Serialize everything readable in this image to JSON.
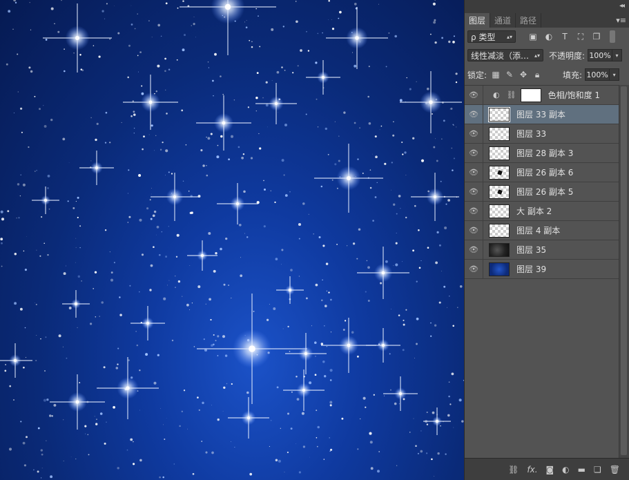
{
  "panel": {
    "collapse_glyph": "◂◂",
    "menu_glyph": "▾≡",
    "tabs": [
      {
        "label": "图层",
        "active": true
      },
      {
        "label": "通道",
        "active": false
      },
      {
        "label": "路径",
        "active": false
      }
    ],
    "filter": {
      "label": "ρ 类型",
      "icons": [
        "image-filter-icon",
        "adjustment-filter-icon",
        "text-filter-icon",
        "shape-filter-icon",
        "smart-object-filter-icon"
      ]
    },
    "blend_mode": "线性减淡（添…",
    "opacity_label": "不透明度:",
    "opacity_value": "100%",
    "lock_label": "锁定:",
    "fill_label": "填充:",
    "fill_value": "100%"
  },
  "layers": [
    {
      "name": "色相/饱和度 1",
      "type": "adjustment",
      "selected": false
    },
    {
      "name": "图层 33 副本",
      "type": "transparent",
      "selected": true
    },
    {
      "name": "图层 33",
      "type": "transparent",
      "selected": false
    },
    {
      "name": "图层 28 副本 3",
      "type": "transparent",
      "selected": false
    },
    {
      "name": "图层 26 副本 6",
      "type": "transparent-mark",
      "selected": false
    },
    {
      "name": "图层 26 副本 5",
      "type": "transparent-mark",
      "selected": false
    },
    {
      "name": "大 副本 2",
      "type": "transparent",
      "selected": false
    },
    {
      "name": "图层 4 副本",
      "type": "transparent",
      "selected": false
    },
    {
      "name": "图层 35",
      "type": "dark",
      "selected": false
    },
    {
      "name": "图层 39",
      "type": "blue",
      "selected": false
    }
  ],
  "colors": {
    "panel_bg": "#535353",
    "selected_row": "#60707f",
    "canvas_blue": "#0f3aa0"
  }
}
